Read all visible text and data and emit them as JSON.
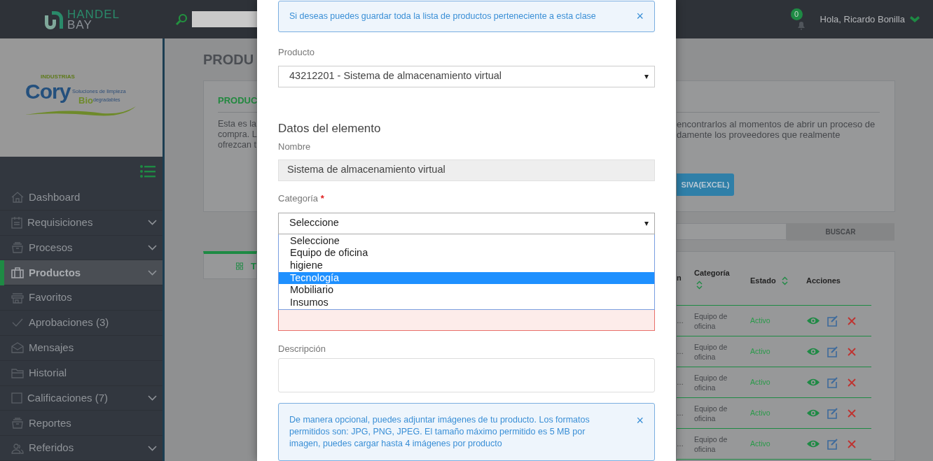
{
  "header": {
    "brand_top": "HANDEL",
    "brand_bottom": "BAY",
    "notifications": "0",
    "greeting": "Hola, Ricardo Bonilla"
  },
  "company_logo": {
    "line_top": "INDUSTRIAS",
    "name": "Cory",
    "tagline": "Soluciones de limpieza",
    "bio": "Bio",
    "tagline_2": "degradables"
  },
  "sidebar": {
    "items": [
      {
        "label": "Dashboard",
        "has_submenu": false,
        "selected": false
      },
      {
        "label": "Requisiciones",
        "has_submenu": true,
        "selected": false
      },
      {
        "label": "Procesos",
        "has_submenu": true,
        "selected": false
      },
      {
        "label": "Productos",
        "has_submenu": true,
        "selected": true
      },
      {
        "label": "Favoritos",
        "has_submenu": false,
        "selected": false
      },
      {
        "label": "Aprobaciones (3)",
        "has_submenu": false,
        "selected": false
      },
      {
        "label": "Mensajes",
        "has_submenu": false,
        "selected": false
      },
      {
        "label": "Historial",
        "has_submenu": false,
        "selected": false
      },
      {
        "label": "Calificaciones (7)",
        "has_submenu": true,
        "selected": false
      },
      {
        "label": "Reportes",
        "has_submenu": false,
        "selected": false
      },
      {
        "label": "Referidos",
        "has_submenu": true,
        "selected": false
      }
    ]
  },
  "page": {
    "title": "PRODU",
    "card": {
      "heading": "PRODUC",
      "text_left": [
        "Esta es la",
        "compra. L",
        "ofrezcan t"
      ],
      "text_right": [
        "encontrarlos al momentos de abrir un proceso de",
        "damente los proveedores que realmente"
      ],
      "button": "SIVA(EXCEL)"
    },
    "search_button": "BUSCAR",
    "tab": {
      "label": "T",
      "selected": true
    },
    "table": {
      "columns": [
        "n",
        "Categoría",
        "Estado",
        "Acciones"
      ],
      "rows": [
        {
          "column_1": "…",
          "category": "Equipo de oficina",
          "status": "Activo"
        },
        {
          "column_1": "…",
          "category": "Equipo de oficina",
          "status": "Activo"
        },
        {
          "column_1": "…",
          "category": "Equipo de oficina",
          "status": "Activo"
        },
        {
          "column_1": "…",
          "category": "Equipo de oficina",
          "status": "Activo"
        },
        {
          "column_1": "…",
          "category": "Equipo de oficina",
          "status": "Activo"
        }
      ]
    }
  },
  "modal": {
    "alert_top": "Si deseas puedes guardar toda la lista de productos perteneciente a esta clase",
    "alert_close": "×",
    "product_label": "Producto",
    "product_value": "43212201 - Sistema de almacenamiento virtual",
    "product_arrow": "▾",
    "section_title": "Datos del elemento",
    "name_label": "Nombre",
    "name_value": "Sistema de almacenamiento virtual",
    "category_label": "Categoría",
    "category_required": "*",
    "category_value": "Seleccione",
    "category_arrow": "▾",
    "category_options": [
      {
        "label": "Seleccione",
        "selected": false
      },
      {
        "label": "Equipo de oficina",
        "selected": false
      },
      {
        "label": "higiene",
        "selected": false
      },
      {
        "label": "Tecnología",
        "selected": true
      },
      {
        "label": "Mobiliario",
        "selected": false
      },
      {
        "label": "Insumos",
        "selected": false
      }
    ],
    "description_label": "Descripción",
    "alert_bottom": "De manera opcional, puedes adjuntar imágenes de tu producto. Los formatos permitidos son: JPG, PNG, JPEG. El tamaño máximo permitido es 5 MB por imagen, puedes cargar hasta 4 imágenes por producto",
    "alert_bottom_close": "×"
  }
}
